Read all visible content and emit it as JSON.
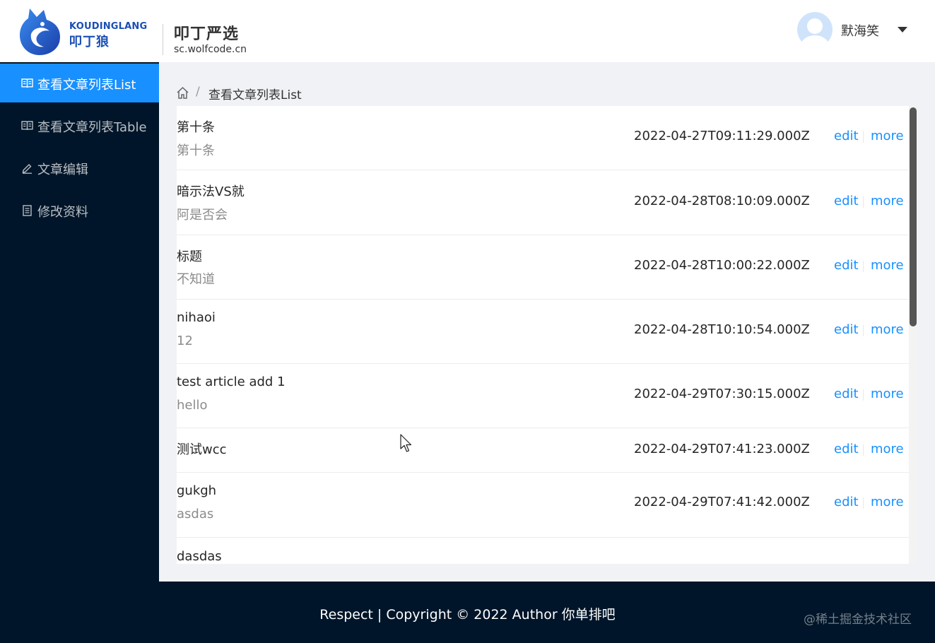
{
  "header": {
    "logo_en": "KOUDINGLANG",
    "logo_cn": "叩丁狼",
    "brand_title": "叩丁严选",
    "brand_url": "sc.wolfcode.cn",
    "username": "默海笑"
  },
  "sidebar": {
    "items": [
      {
        "label": "查看文章列表List",
        "icon": "book-icon",
        "active": true
      },
      {
        "label": "查看文章列表Table",
        "icon": "book-icon",
        "active": false
      },
      {
        "label": "文章编辑",
        "icon": "edit-icon",
        "active": false
      },
      {
        "label": "修改资料",
        "icon": "profile-icon",
        "active": false
      }
    ]
  },
  "breadcrumb": {
    "separator": "/",
    "current": "查看文章列表List"
  },
  "articles": [
    {
      "title": "第十条",
      "desc": "第十条",
      "date": "2022-04-27T09:11:29.000Z",
      "edit": "edit",
      "more": "more"
    },
    {
      "title": "暗示法VS就",
      "desc": "阿是否会",
      "date": "2022-04-28T08:10:09.000Z",
      "edit": "edit",
      "more": "more"
    },
    {
      "title": "标题",
      "desc": "不知道",
      "date": "2022-04-28T10:00:22.000Z",
      "edit": "edit",
      "more": "more"
    },
    {
      "title": "nihaoi",
      "desc": "12",
      "date": "2022-04-28T10:10:54.000Z",
      "edit": "edit",
      "more": "more"
    },
    {
      "title": "test article add 1",
      "desc": "hello",
      "date": "2022-04-29T07:30:15.000Z",
      "edit": "edit",
      "more": "more"
    },
    {
      "title": "测试wcc",
      "desc": "",
      "date": "2022-04-29T07:41:23.000Z",
      "edit": "edit",
      "more": "more"
    },
    {
      "title": "gukgh",
      "desc": "asdas",
      "date": "2022-04-29T07:41:42.000Z",
      "edit": "edit",
      "more": "more"
    },
    {
      "title": "dasdas",
      "desc": "",
      "date": "",
      "edit": "",
      "more": ""
    }
  ],
  "footer": {
    "text": "Respect | Copyright © 2022 Author 你单排吧",
    "watermark": "@稀土掘金技术社区"
  },
  "colors": {
    "accent": "#1890ff",
    "sider": "#001529",
    "content_bg": "#f0f2f5"
  }
}
